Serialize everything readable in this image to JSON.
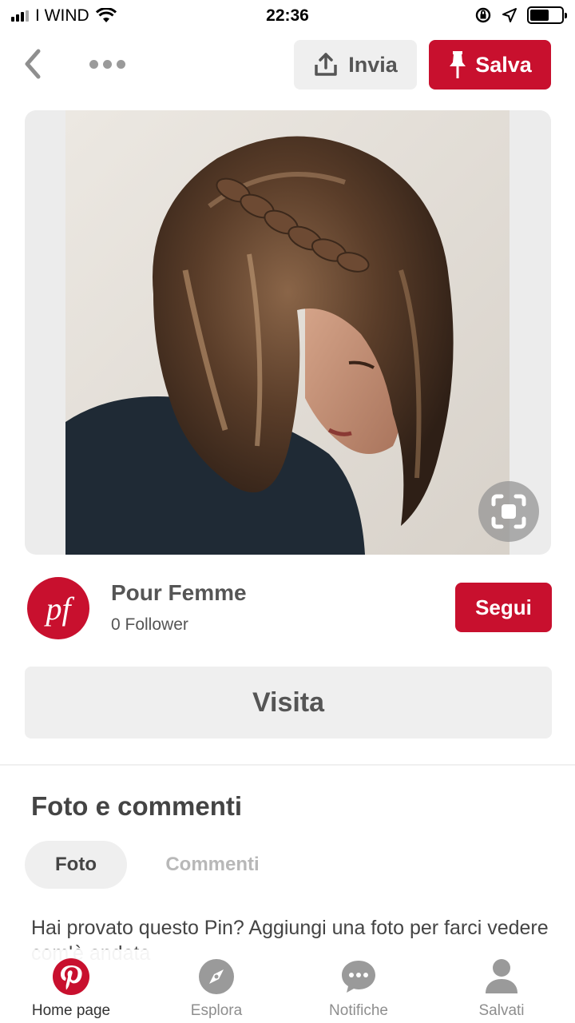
{
  "status_bar": {
    "carrier": "I WIND",
    "time": "22:36",
    "battery_level": 0.6
  },
  "toolbar": {
    "share_label": "Invia",
    "save_label": "Salva",
    "accent_color": "#c8102e"
  },
  "author": {
    "avatar_text": "pf",
    "name": "Pour Femme",
    "followers": "0 Follower",
    "follow_label": "Segui"
  },
  "visit_label": "Visita",
  "photos_section": {
    "title": "Foto e commenti",
    "tabs": [
      {
        "label": "Foto",
        "active": true
      },
      {
        "label": "Commenti",
        "active": false
      }
    ],
    "prompt": "Hai provato questo Pin? Aggiungi una foto per farci vedere com'è andata"
  },
  "bottom_nav": [
    {
      "label": "Home page",
      "icon": "pinterest-logo-icon",
      "active": true
    },
    {
      "label": "Esplora",
      "icon": "compass-icon",
      "active": false
    },
    {
      "label": "Notifiche",
      "icon": "speech-bubble-icon",
      "active": false
    },
    {
      "label": "Salvati",
      "icon": "person-icon",
      "active": false
    }
  ]
}
